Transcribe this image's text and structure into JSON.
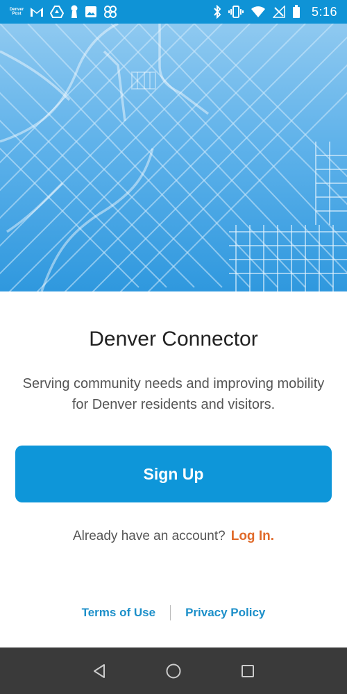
{
  "status_bar": {
    "time": "5:16",
    "news_badge_text": "Denver Post",
    "icons_left": [
      "news-app-icon",
      "gmail-icon",
      "drive-icon",
      "keyhole-icon",
      "image-icon",
      "pinwheel-icon"
    ],
    "icons_right": [
      "bluetooth-icon",
      "vibrate-icon",
      "wifi-icon",
      "no-signal-icon",
      "battery-icon"
    ]
  },
  "app": {
    "title": "Denver Connector",
    "subtitle": "Serving community needs and improving mobility for Denver residents and visitors.",
    "signup_label": "Sign Up",
    "login_prompt": "Already have an account?",
    "login_label": "Log In."
  },
  "footer": {
    "terms_label": "Terms of Use",
    "privacy_label": "Privacy Policy"
  },
  "colors": {
    "primary": "#0e96d9",
    "accent": "#e06a2a",
    "link": "#1c8fc9",
    "nav_bar": "#3a3a3a"
  },
  "nav_bar": {
    "buttons": [
      "back-icon",
      "home-icon",
      "recents-icon"
    ]
  }
}
